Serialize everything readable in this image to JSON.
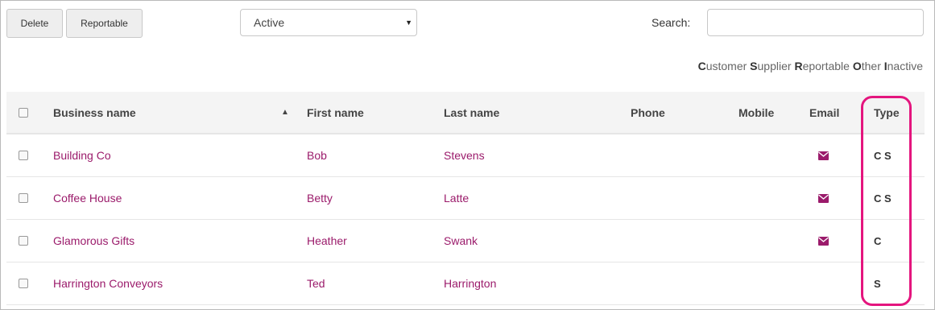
{
  "toolbar": {
    "delete_label": "Delete",
    "reportable_label": "Reportable",
    "status_select_value": "Active",
    "search_label": "Search:",
    "search_value": ""
  },
  "legend": {
    "items": [
      {
        "key": "C",
        "rest": "ustomer"
      },
      {
        "key": "S",
        "rest": "upplier"
      },
      {
        "key": "R",
        "rest": "eportable"
      },
      {
        "key": "O",
        "rest": "ther"
      },
      {
        "key": "I",
        "rest": "nactive"
      }
    ]
  },
  "table": {
    "headers": {
      "business_name": "Business name",
      "sort_indicator": "▲",
      "first_name": "First name",
      "last_name": "Last name",
      "phone": "Phone",
      "mobile": "Mobile",
      "email": "Email",
      "type": "Type"
    },
    "rows": [
      {
        "business_name": "Building Co",
        "first_name": "Bob",
        "last_name": "Stevens",
        "phone": "",
        "mobile": "",
        "has_email": true,
        "type": "C S"
      },
      {
        "business_name": "Coffee House",
        "first_name": "Betty",
        "last_name": "Latte",
        "phone": "",
        "mobile": "",
        "has_email": true,
        "type": "C S"
      },
      {
        "business_name": "Glamorous Gifts",
        "first_name": "Heather",
        "last_name": "Swank",
        "phone": "",
        "mobile": "",
        "has_email": true,
        "type": "C"
      },
      {
        "business_name": "Harrington Conveyors",
        "first_name": "Ted",
        "last_name": "Harrington",
        "phone": "",
        "mobile": "",
        "has_email": false,
        "type": "S"
      }
    ]
  },
  "icons": {
    "email": "envelope-icon",
    "select_caret": "caret-down-icon",
    "sort": "sort-asc-icon"
  },
  "colors": {
    "link": "#9b1b6b",
    "highlight": "#e4157e"
  }
}
